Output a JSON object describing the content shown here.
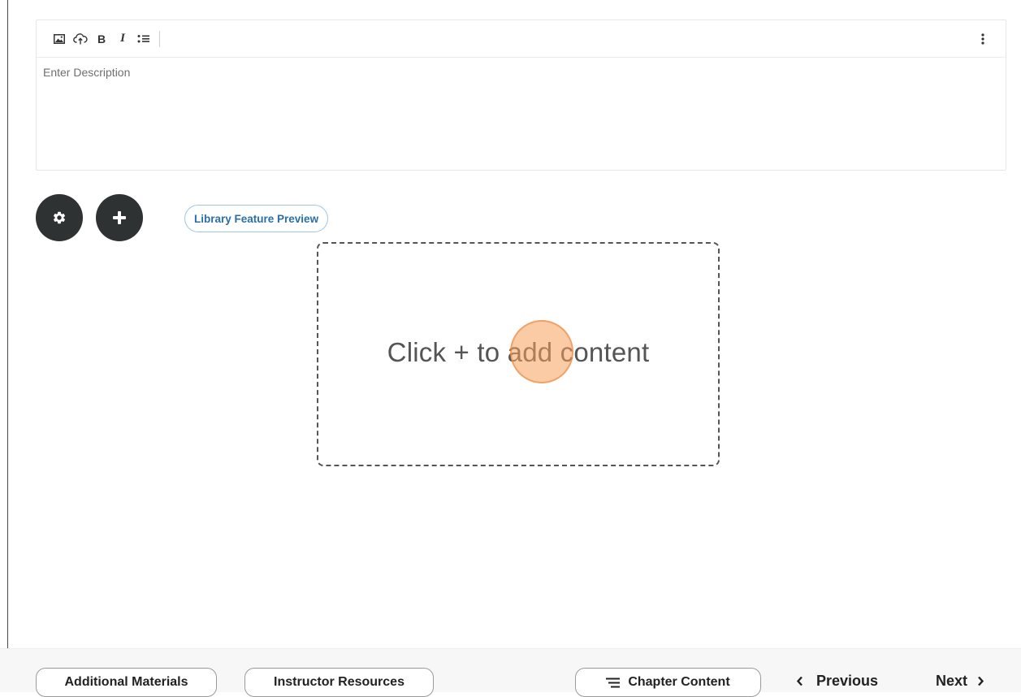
{
  "editor": {
    "toolbar": {
      "image_icon": "image-icon",
      "upload_icon": "cloud-upload-icon",
      "bold_label": "B",
      "italic_label": "I",
      "list_icon": "bulleted-list-icon",
      "more_icon": "vertical-ellipsis-icon"
    },
    "description_placeholder": "Enter Description"
  },
  "actions": {
    "settings_icon": "gear-icon",
    "add_icon": "plus-icon",
    "library_preview_label": "Library Feature Preview"
  },
  "drop_area": {
    "text": "Click + to add content"
  },
  "footer": {
    "additional_materials": "Additional Materials",
    "instructor_resources": "Instructor Resources",
    "chapter_content": "Chapter Content",
    "previous": "Previous",
    "next": "Next"
  },
  "colors": {
    "round_button_bg": "#2f3232",
    "preview_pill_text": "#2a6fa8",
    "preview_pill_border": "#9fc6e4",
    "click_indicator": "#f5a05a"
  }
}
